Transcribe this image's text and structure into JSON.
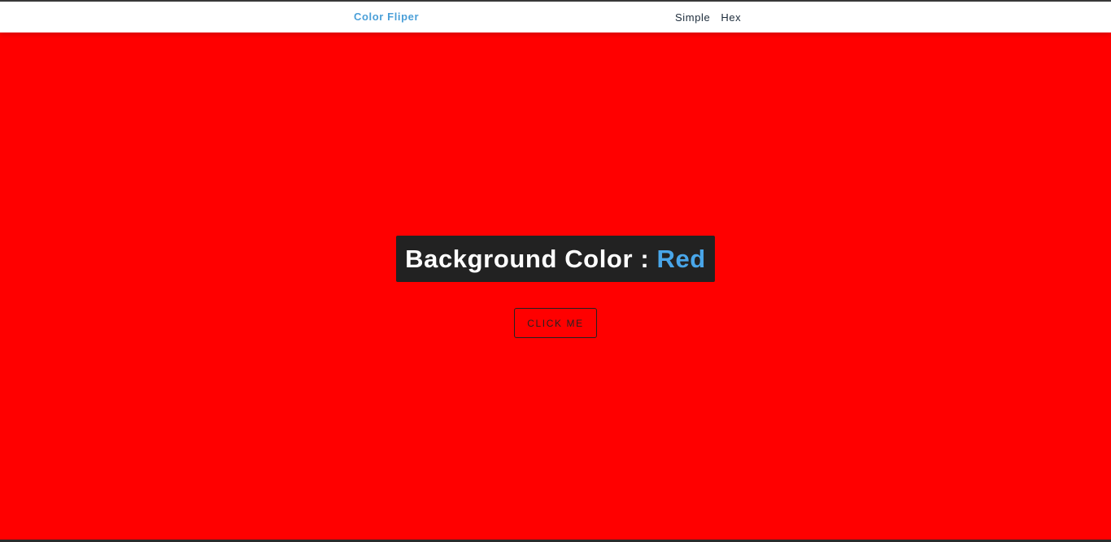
{
  "navbar": {
    "brand": "Color Fliper",
    "links": [
      {
        "label": "Simple"
      },
      {
        "label": "Hex"
      }
    ]
  },
  "main": {
    "heading_prefix": "Background Color : ",
    "color_name": "Red",
    "button_label": "click me"
  },
  "colors": {
    "background": "#ff0000",
    "brand": "#4a9fd8",
    "color_value": "#49a6e9",
    "box": "#222222",
    "navbar": "#ffffff"
  }
}
